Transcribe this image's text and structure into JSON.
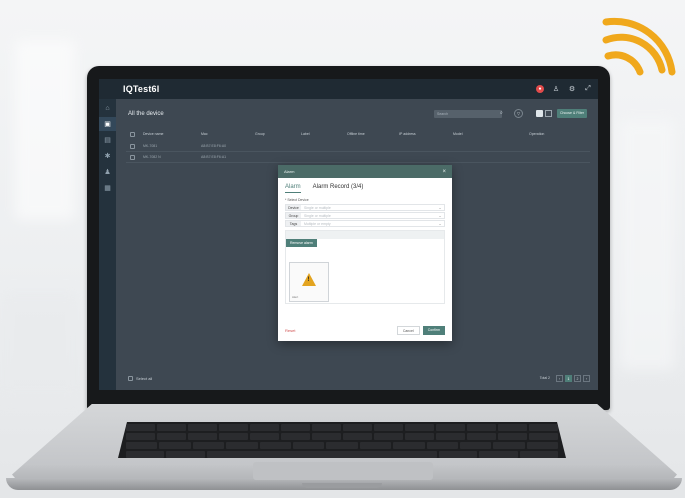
{
  "topbar": {
    "logo": "IQTest6l"
  },
  "page": {
    "title": "All the device",
    "search_placeholder": "Search",
    "add_button": "Choose & Filter"
  },
  "table": {
    "columns": [
      "Device name",
      "Mac",
      "Group",
      "Label",
      "Offline time",
      "IP address",
      "Model",
      "Operation"
    ],
    "rows": [
      {
        "name": "MK-7081",
        "mac": "A8:B7:E8:F6:A0"
      },
      {
        "name": "MK-7082 N",
        "mac": "A8:B7:E8:F6:A1"
      }
    ]
  },
  "footer": {
    "select_all": "Select all",
    "total": "Total 2",
    "pages": [
      "1",
      "2"
    ],
    "current_page": "1"
  },
  "modal": {
    "title": "Alarm",
    "close": "×",
    "tabs": [
      {
        "label": "Alarm"
      },
      {
        "label": "Alarm Record (3/4)"
      }
    ],
    "select_label": "* Select Device",
    "fields": [
      {
        "label": "Device",
        "placeholder": "Single or multiple"
      },
      {
        "label": "Group",
        "placeholder": "Single or multiple"
      },
      {
        "label": "Tags",
        "placeholder": "Multiple or empty"
      }
    ],
    "remove_button": "Remove alarm",
    "card_caption": "Alert",
    "reset": "Reset",
    "cancel": "Cancel",
    "confirm": "Confirm"
  },
  "colors": {
    "accent": "#4f7f79",
    "wifi": "#f0a81c",
    "warning": "#e3a420"
  }
}
